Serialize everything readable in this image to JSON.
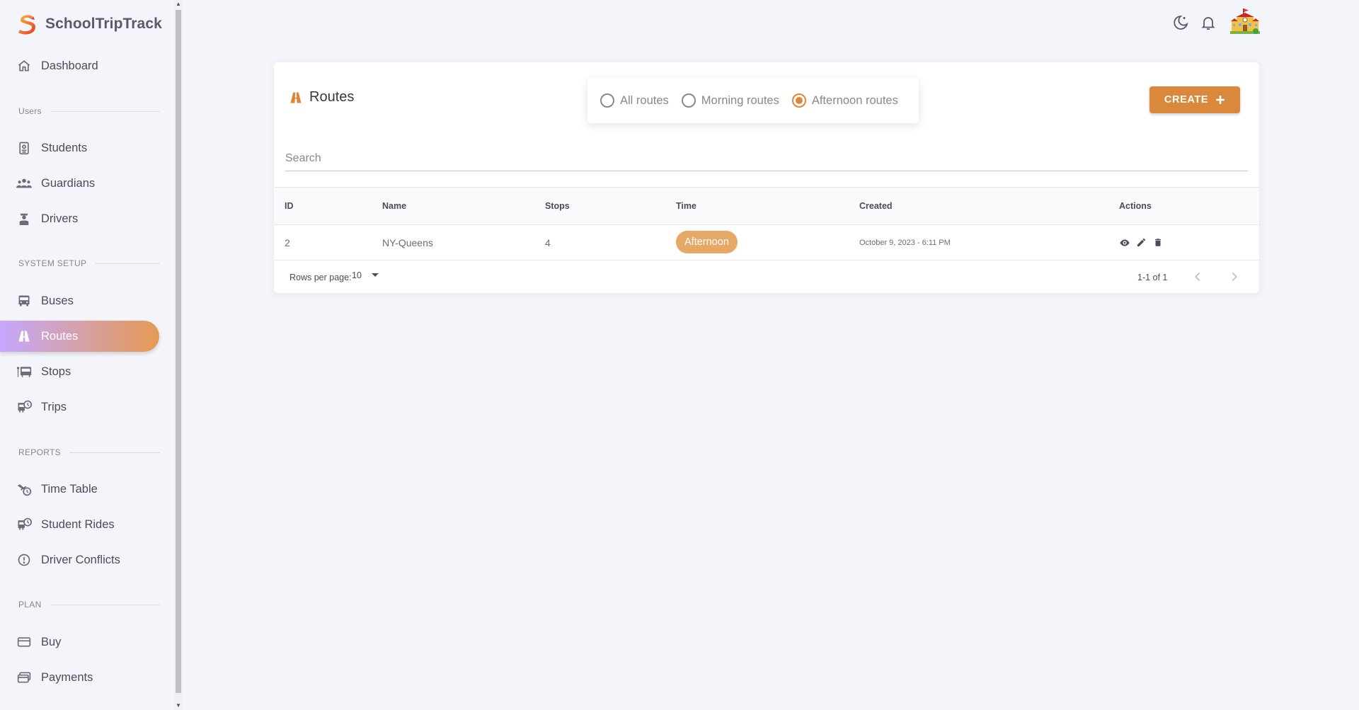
{
  "app": {
    "name": "SchoolTripTrack"
  },
  "sidebar": {
    "dashboard": "Dashboard",
    "sections": {
      "users": "Users",
      "system_setup": "SYSTEM SETUP",
      "reports": "REPORTS",
      "plan": "PLAN"
    },
    "items": {
      "students": "Students",
      "guardians": "Guardians",
      "drivers": "Drivers",
      "buses": "Buses",
      "routes": "Routes",
      "stops": "Stops",
      "trips": "Trips",
      "time_table": "Time Table",
      "student_rides": "Student Rides",
      "driver_conflicts": "Driver Conflicts",
      "buy": "Buy",
      "payments": "Payments"
    },
    "active": "routes"
  },
  "topbar": {
    "icons": [
      "moon-star-icon",
      "bell-icon",
      "school-avatar"
    ]
  },
  "page": {
    "title": "Routes",
    "filters": {
      "options": [
        "All routes",
        "Morning routes",
        "Afternoon routes"
      ],
      "selected": "Afternoon routes"
    },
    "create_label": "CREATE",
    "search_placeholder": "Search"
  },
  "table": {
    "headers": {
      "id": "ID",
      "name": "Name",
      "stops": "Stops",
      "time": "Time",
      "created": "Created",
      "actions": "Actions"
    },
    "rows": [
      {
        "id": "2",
        "name": "NY-Queens",
        "stops": "4",
        "time": "Afternoon",
        "created": "October 9, 2023 - 6:11 PM"
      }
    ],
    "footer": {
      "rows_per_page_label": "Rows per page:",
      "rows_per_page_value": "10",
      "range": "1-1 of 1"
    }
  },
  "colors": {
    "accent": "#d9883c",
    "chip": "#e5a866",
    "active_gradient_start": "#c6a7fe",
    "active_gradient_end": "#e59a54"
  }
}
